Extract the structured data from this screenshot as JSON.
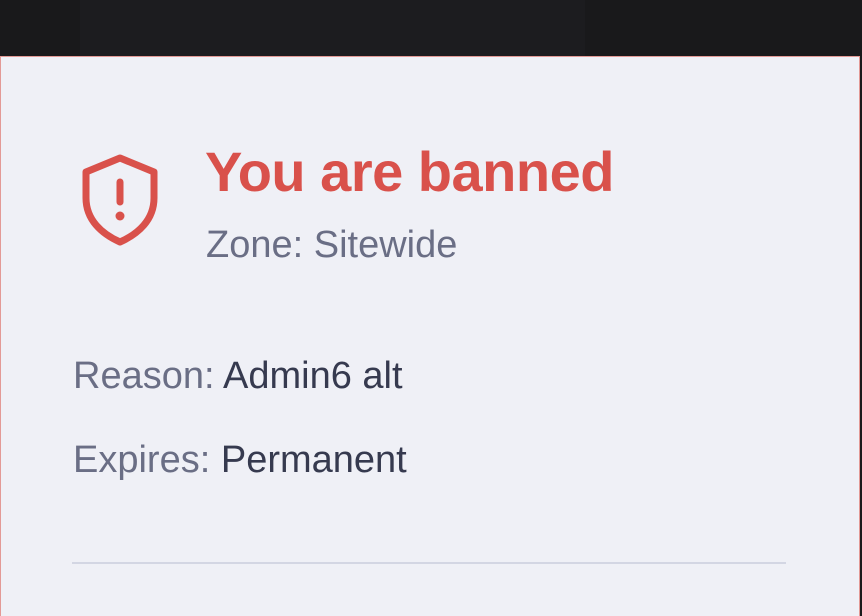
{
  "ban_notice": {
    "title": "You are banned",
    "zone_label": "Zone:",
    "zone_value": "Sitewide",
    "reason_label": "Reason:",
    "reason_value": "Admin6 alt",
    "expires_label": "Expires:",
    "expires_value": "Permanent",
    "icon": "shield-alert-icon"
  },
  "colors": {
    "accent": "#d9514b",
    "label": "#6a6e85",
    "value": "#363a4f",
    "background": "#eff0f6",
    "divider": "#d3d6e3"
  }
}
